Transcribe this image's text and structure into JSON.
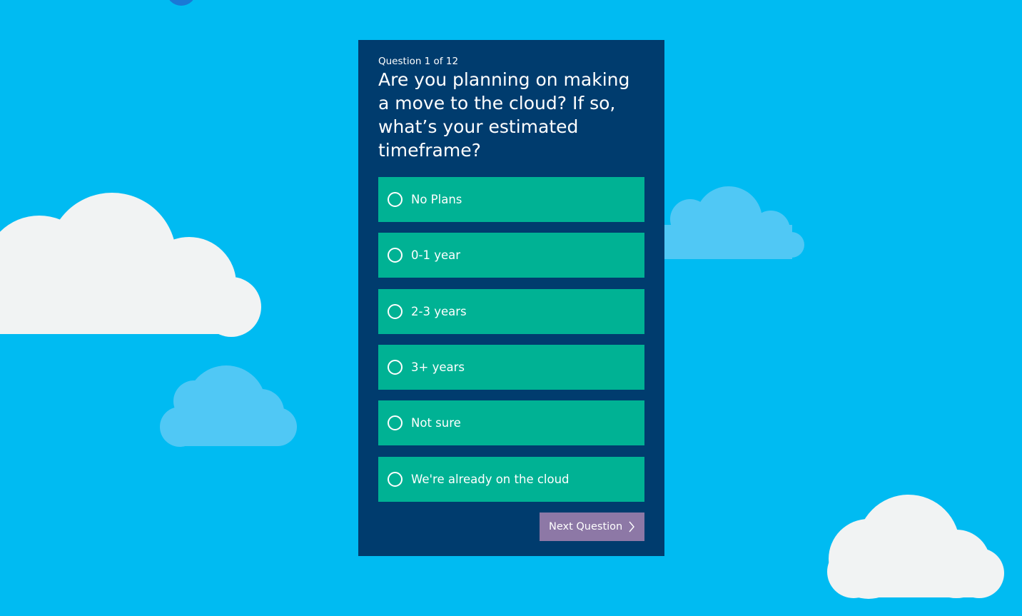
{
  "quiz": {
    "counter": "Question 1 of 12",
    "question": "Are you planning on making a move to the cloud? If so, what’s your estimated timeframe?",
    "options": [
      {
        "label": "No Plans",
        "selected": false
      },
      {
        "label": "0-1 year",
        "selected": false
      },
      {
        "label": "2-3 years",
        "selected": false
      },
      {
        "label": "3+ years",
        "selected": false
      },
      {
        "label": "Not sure",
        "selected": false
      },
      {
        "label": "We're already on the cloud",
        "selected": false
      }
    ],
    "next_label": "Next Question",
    "next_icon": "chevron-right-icon"
  },
  "colors": {
    "background": "#00bbf2",
    "panel": "#003c6e",
    "option": "#00b294",
    "button": "#8d78a6",
    "cloud_white": "#f1f3f3",
    "cloud_blue": "#50c8f5"
  }
}
